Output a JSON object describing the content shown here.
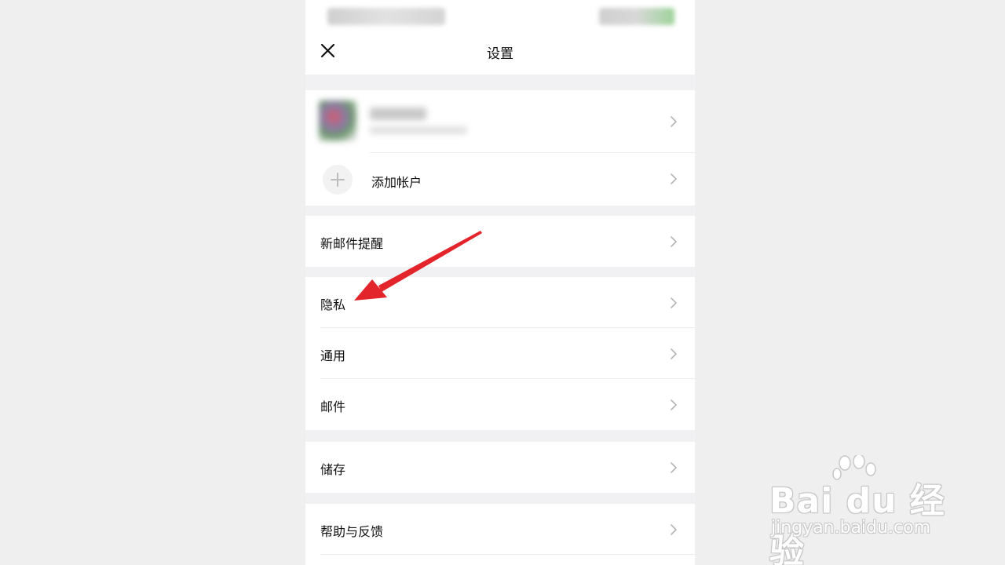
{
  "header": {
    "title": "设置"
  },
  "account": {
    "add_label": "添加帐户"
  },
  "menu": {
    "notifications_label": "新邮件提醒",
    "privacy_label": "隐私",
    "general_label": "通用",
    "mail_label": "邮件",
    "storage_label": "储存",
    "help_label": "帮助与反馈"
  },
  "icons": {
    "close": "close-icon",
    "chevron": "chevron-right-icon",
    "add": "plus-icon",
    "annotation": "red-arrow-annotation"
  },
  "colors": {
    "background": "#f1f1f3",
    "card": "#ffffff",
    "annotation_arrow": "#e3242b"
  },
  "watermark": {
    "logo": "Bai du 经验",
    "url": "jingyan.baidu.com"
  }
}
